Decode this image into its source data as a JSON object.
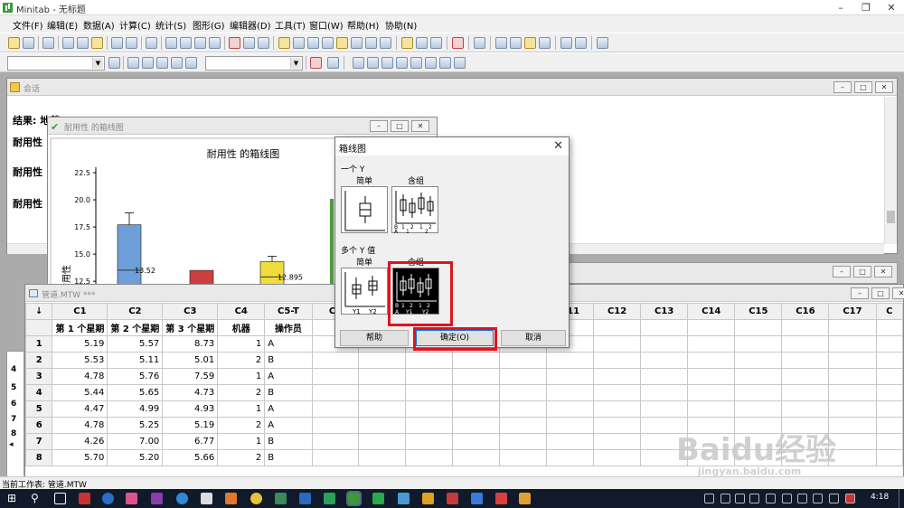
{
  "app": {
    "title": "Minitab - 无标题",
    "minimize": "–",
    "restore": "❐",
    "close": "✕"
  },
  "menu": [
    "文件(F)",
    "编辑(E)",
    "数据(A)",
    "计算(C)",
    "统计(S)",
    "图形(G)",
    "编辑器(D)",
    "工具(T)",
    "窗口(W)",
    "帮助(H)",
    "协助(N)"
  ],
  "session": {
    "title": "会话",
    "result_header": "结果: 地毯.MTW",
    "lines": [
      "耐用性",
      "耐用性",
      "耐用性"
    ]
  },
  "graph_window": {
    "title": "耐用性 的箱线图"
  },
  "chart_data": {
    "type": "box",
    "title": "耐用性 的箱线图",
    "ylabel": "耐用性",
    "ylim": [
      12.5,
      22.5
    ],
    "yticks": [
      "22.5",
      "20.0",
      "17.5",
      "15.0",
      "12.5"
    ],
    "boxes": [
      {
        "color": "#6f9fd8",
        "q3": 17.7,
        "median": 13.52,
        "whisker_high": 18.8
      },
      {
        "color": "#cc3f3f",
        "q3": 13.5
      },
      {
        "color": "#f0dc3c",
        "q3": 14.3,
        "median": 12.895,
        "whisker_high": 14.8
      }
    ],
    "annotations": [
      "13.52",
      "12.895"
    ]
  },
  "worksheet": {
    "title": "管道.MTW ***",
    "arrow": "↓",
    "columns": [
      "C1",
      "C2",
      "C3",
      "C4",
      "C5-T",
      "C6",
      "C7",
      "C8",
      "C9",
      "C10",
      "C11",
      "C12",
      "C13",
      "C14",
      "C15",
      "C16",
      "C17",
      "C"
    ],
    "names": [
      "第 1 个星期",
      "第 2 个星期",
      "第 3 个星期",
      "机器",
      "操作员",
      "",
      "",
      "",
      "",
      "",
      "",
      "",
      "",
      "",
      "",
      "",
      "",
      ""
    ],
    "rows": [
      [
        "1",
        "5.19",
        "5.57",
        "8.73",
        "1",
        "A"
      ],
      [
        "2",
        "5.53",
        "5.11",
        "5.01",
        "2",
        "B"
      ],
      [
        "3",
        "4.78",
        "5.76",
        "7.59",
        "1",
        "A"
      ],
      [
        "4",
        "5.44",
        "5.65",
        "4.73",
        "2",
        "B"
      ],
      [
        "5",
        "4.47",
        "4.99",
        "4.93",
        "1",
        "A"
      ],
      [
        "6",
        "4.78",
        "5.25",
        "5.19",
        "2",
        "A"
      ],
      [
        "7",
        "4.26",
        "7.00",
        "6.77",
        "1",
        "B"
      ],
      [
        "8",
        "5.70",
        "5.20",
        "5.66",
        "2",
        "B"
      ]
    ]
  },
  "left_rows": [
    "4",
    "5",
    "6",
    "7",
    "8"
  ],
  "dialog": {
    "title": "箱线图",
    "close": "✕",
    "group_one_y": "一个 Y",
    "group_multi_y": "多个 Y 值",
    "simple": "简单",
    "with_groups": "含组",
    "simple2": "简单",
    "with_groups2": "含组",
    "thumb_labels": {
      "a": "A",
      "b": "B",
      "one": "1",
      "two": "2",
      "y1": "Y1",
      "y2": "Y2"
    },
    "help_button": "帮助",
    "ok_button": "确定(O)",
    "cancel_button": "取消"
  },
  "status_bar": {
    "text": "当前工作表: 管道.MTW"
  },
  "taskbar": {
    "time": "4:18"
  },
  "watermark": {
    "logo": "Baidu经验",
    "url": "jingyan.baidu.com"
  }
}
